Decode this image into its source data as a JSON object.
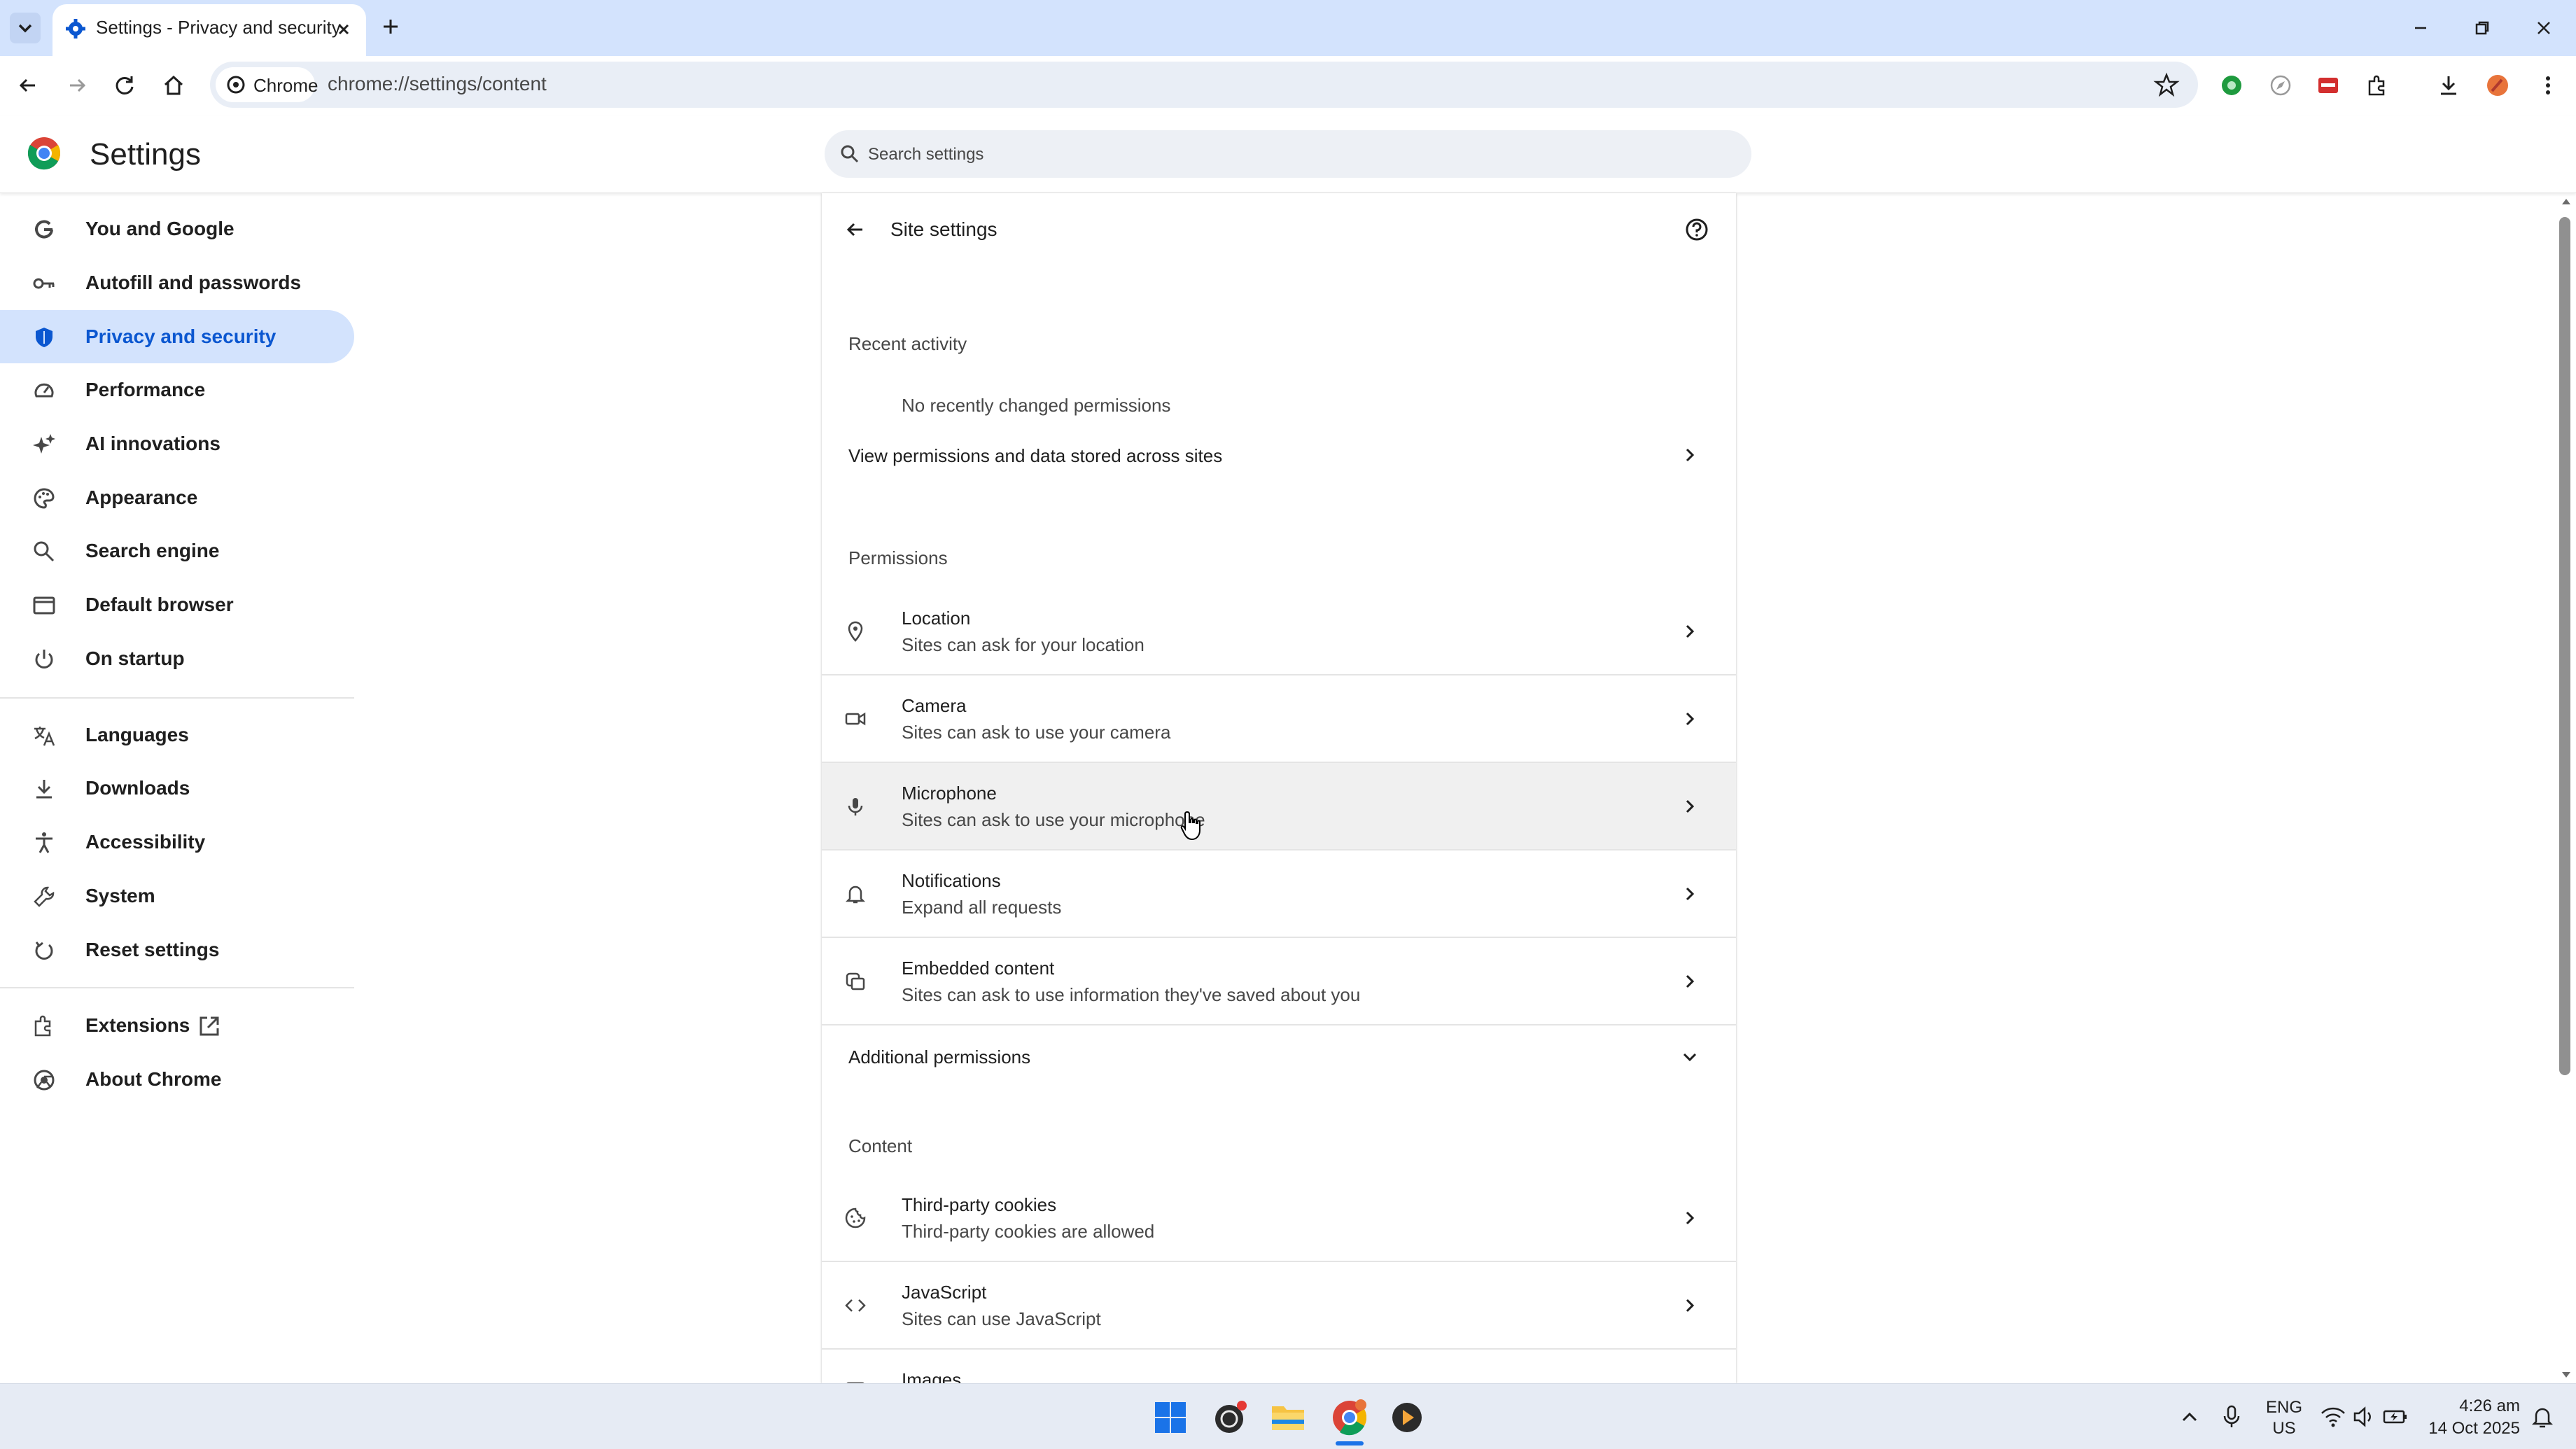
{
  "browser": {
    "tab_title": "Settings - Privacy and security",
    "chip_label": "Chrome",
    "url": "chrome://settings/content"
  },
  "header": {
    "title": "Settings",
    "search_placeholder": "Search settings"
  },
  "sidebar": {
    "items": [
      {
        "label": "You and Google",
        "icon": "google-icon"
      },
      {
        "label": "Autofill and passwords",
        "icon": "key-icon"
      },
      {
        "label": "Privacy and security",
        "icon": "shield-icon",
        "active": true
      },
      {
        "label": "Performance",
        "icon": "speedometer-icon"
      },
      {
        "label": "AI innovations",
        "icon": "sparkle-icon"
      },
      {
        "label": "Appearance",
        "icon": "palette-icon"
      },
      {
        "label": "Search engine",
        "icon": "search-icon"
      },
      {
        "label": "Default browser",
        "icon": "browser-window-icon"
      },
      {
        "label": "On startup",
        "icon": "power-icon"
      },
      {
        "label": "Languages",
        "icon": "translate-icon"
      },
      {
        "label": "Downloads",
        "icon": "download-icon"
      },
      {
        "label": "Accessibility",
        "icon": "accessibility-icon"
      },
      {
        "label": "System",
        "icon": "wrench-icon"
      },
      {
        "label": "Reset settings",
        "icon": "reset-icon"
      },
      {
        "label": "Extensions",
        "icon": "puzzle-icon"
      },
      {
        "label": "About Chrome",
        "icon": "chrome-icon"
      }
    ]
  },
  "main": {
    "page_title": "Site settings",
    "recent_activity": {
      "heading": "Recent activity",
      "empty_text": "No recently changed permissions"
    },
    "view_permissions_label": "View permissions and data stored across sites",
    "permissions": {
      "heading": "Permissions",
      "items": [
        {
          "title": "Location",
          "subtitle": "Sites can ask for your location",
          "icon": "location-pin-icon"
        },
        {
          "title": "Camera",
          "subtitle": "Sites can ask to use your camera",
          "icon": "camera-icon"
        },
        {
          "title": "Microphone",
          "subtitle": "Sites can ask to use your microphone",
          "icon": "microphone-icon"
        },
        {
          "title": "Notifications",
          "subtitle": "Expand all requests",
          "icon": "bell-icon"
        },
        {
          "title": "Embedded content",
          "subtitle": "Sites can ask to use information they've saved about you",
          "icon": "embedded-content-icon"
        }
      ]
    },
    "additional_permissions_label": "Additional permissions",
    "content": {
      "heading": "Content",
      "items": [
        {
          "title": "Third-party cookies",
          "subtitle": "Third-party cookies are allowed",
          "icon": "cookie-icon"
        },
        {
          "title": "JavaScript",
          "subtitle": "Sites can use JavaScript",
          "icon": "code-icon"
        },
        {
          "title": "Images",
          "subtitle": "",
          "icon": "image-icon"
        }
      ]
    }
  },
  "taskbar": {
    "lang_primary": "ENG",
    "lang_secondary": "US",
    "time": "4:26 am",
    "date": "14 Oct 2025"
  },
  "colors": {
    "accent": "#0b57d0",
    "active_bg": "#d3e3fd",
    "tabstrip_bg": "#d3e3fd"
  }
}
